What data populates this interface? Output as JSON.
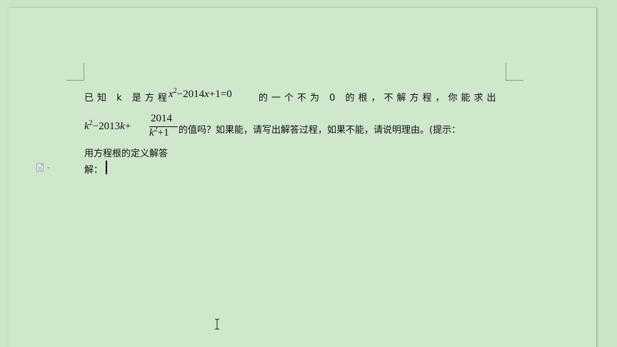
{
  "document": {
    "line1": {
      "prefix": "已知 k 是方程",
      "equation": {
        "var": "x",
        "exp": "2",
        "rest1": "−2014",
        "var2": "x",
        "rest2": "+1=0"
      },
      "suffix": "的一个不为 0 的根，不解方程，你能求出"
    },
    "line2": {
      "lead": {
        "var": "k",
        "exp": "2",
        "rest": "−2013",
        "var2": "k",
        "plus": "+"
      },
      "fraction": {
        "numerator": "2014",
        "den_var": "k",
        "den_exp": "2",
        "den_rest": "+1"
      },
      "suffix": "的值吗？如果能，请写出解答过程，如果不能，请说明理由。(提示："
    },
    "line3": "用方程根的定义解答",
    "line4": "解："
  },
  "icons": {
    "paragraph_marker": "doc-options-icon",
    "cursor": "text-ibeam-cursor"
  },
  "colors": {
    "page_background": "#cfe8cc",
    "desk_background": "#c9e4c6",
    "text": "#111111"
  }
}
